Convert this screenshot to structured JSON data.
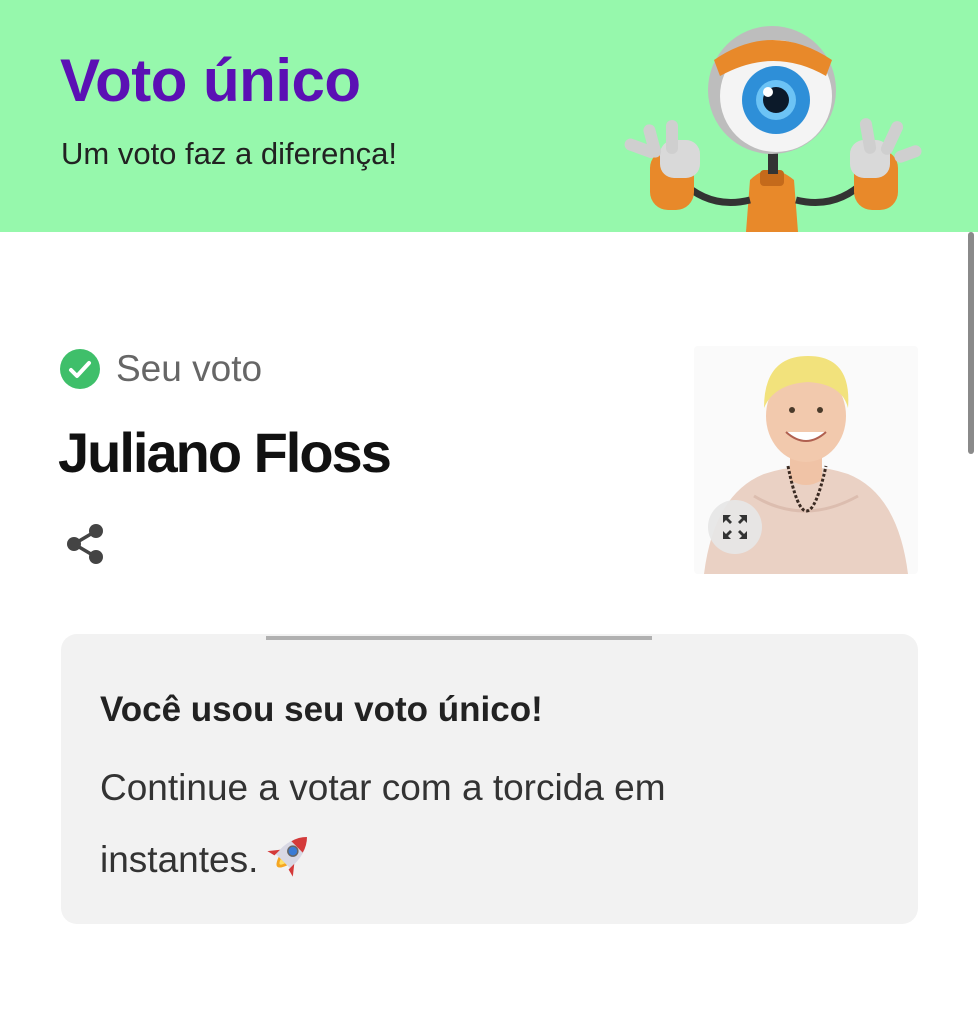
{
  "header": {
    "title": "Voto único",
    "subtitle": "Um voto faz a diferença!",
    "background_color": "#96f8ac",
    "title_color": "#5b10b4",
    "mascot_icon": "big-brother-eye-robot"
  },
  "vote": {
    "status_label": "Seu voto",
    "status_icon": "check-circle-icon",
    "candidate_name": "Juliano Floss",
    "share_icon": "share-icon",
    "expand_icon": "expand-icon"
  },
  "message": {
    "title": "Você usou seu voto único!",
    "body": "Continue a votar com a torcida em instantes.",
    "emoji_icon": "rocket-icon"
  },
  "colors": {
    "check_green": "#3fbf6a",
    "card_background": "#f2f2f2"
  }
}
